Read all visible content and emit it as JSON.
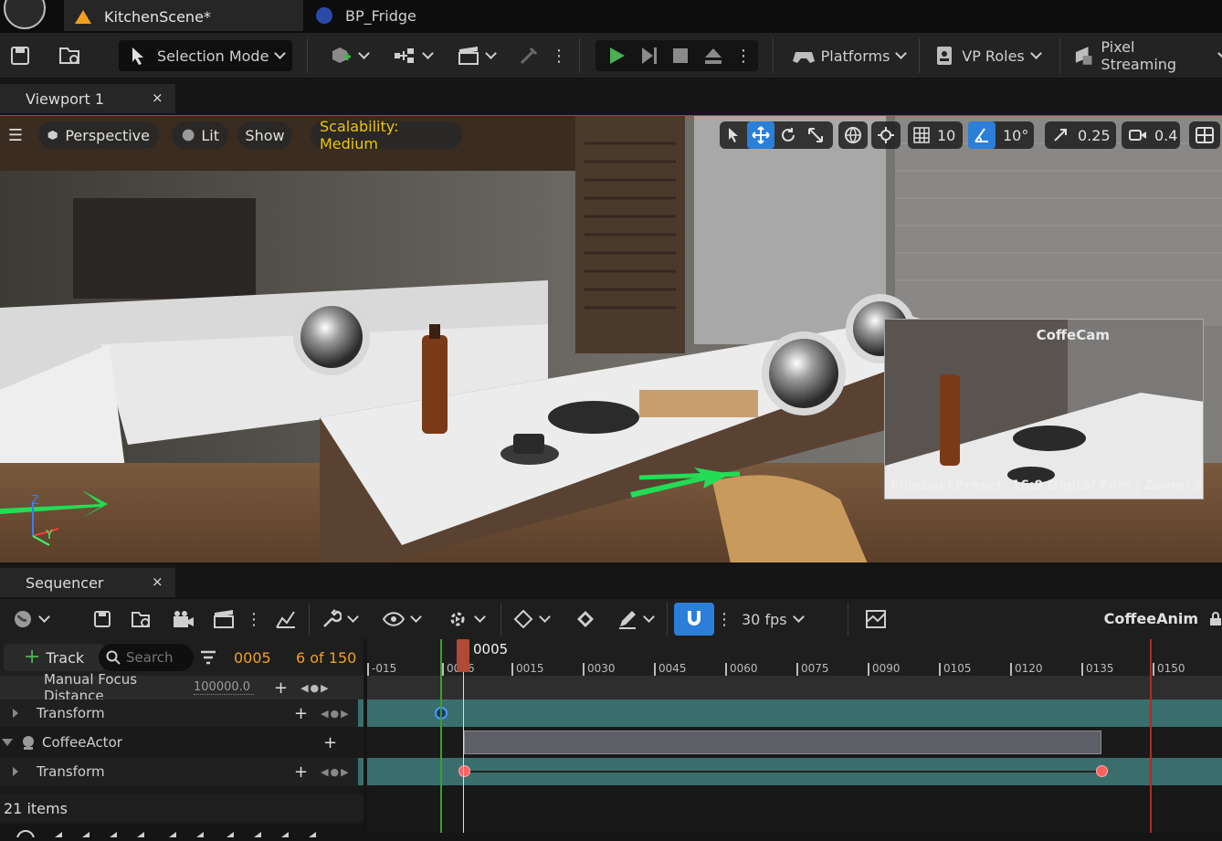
{
  "tabs": [
    {
      "label": "KitchenScene*"
    },
    {
      "label": "BP_Fridge"
    }
  ],
  "toolbar": {
    "selection_mode": "Selection Mode",
    "platforms": "Platforms",
    "vp_roles": "VP Roles",
    "pixel_streaming": "Pixel Streaming"
  },
  "viewport_panel": {
    "tab_label": "Viewport 1",
    "close": "×"
  },
  "viewport": {
    "perspective": "Perspective",
    "lit": "Lit",
    "show": "Show",
    "scalability": "Scalability: Medium",
    "grid_snap": "10",
    "rot_snap": "10°",
    "scale_snap": "0.25",
    "cam_speed": "0.4",
    "pip_title": "CoffeCam",
    "pip_footer": "FilmbackPreset: 16:9 Digital Film | Zoom: 3",
    "axis_z": "Z",
    "axis_y": "Y"
  },
  "sequencer": {
    "tab_label": "Sequencer",
    "close": "×",
    "fps": "30 fps",
    "sequence_name": "CoffeeAnim",
    "track_button": "Track",
    "search_placeholder": "Search",
    "current_frame": "0005",
    "frame_count": "6 of 150",
    "playhead_label": "0005",
    "items_count": "21 items",
    "ruler": [
      "-015",
      "0006",
      "0015",
      "0030",
      "0045",
      "0060",
      "0075",
      "0090",
      "0105",
      "0120",
      "0135",
      "0150"
    ],
    "rows": [
      {
        "label": "Manual Focus Distance",
        "value": "100000.0"
      },
      {
        "label": "Transform"
      },
      {
        "label": "CoffeeActor"
      },
      {
        "label": "Transform"
      }
    ]
  },
  "colors": {
    "accent": "#2b7fd9",
    "play": "#4caf50",
    "frame": "#f0a020",
    "track": "#3a6e6c",
    "scalability": "#f2c400"
  }
}
